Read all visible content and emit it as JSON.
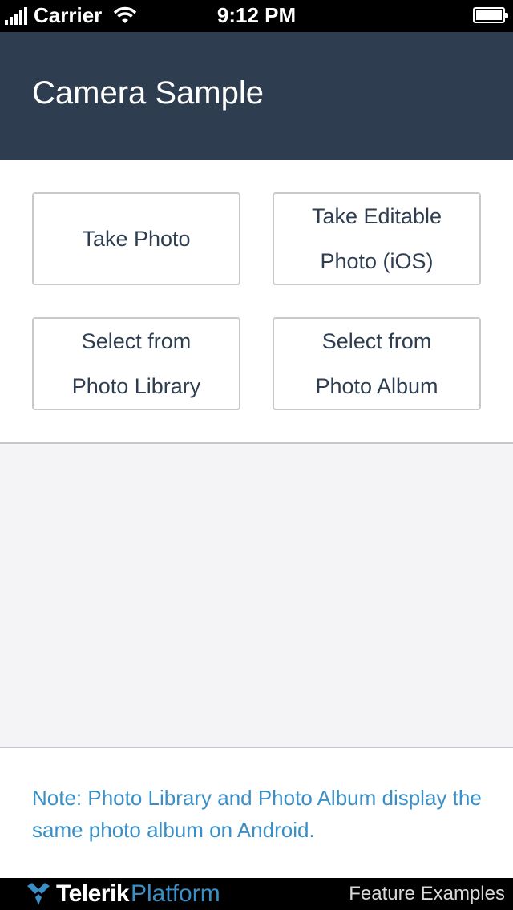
{
  "status_bar": {
    "carrier": "Carrier",
    "time": "9:12 PM",
    "icons": [
      "signal-icon",
      "wifi-icon",
      "battery-icon"
    ]
  },
  "header": {
    "title": "Camera Sample",
    "background": "#2e3e50"
  },
  "buttons": {
    "take_photo": "Take Photo",
    "take_editable_line1": "Take Editable",
    "take_editable_line2": "Photo (iOS)",
    "select_library_line1": "Select from",
    "select_library_line2": "Photo Library",
    "select_album_line1": "Select from",
    "select_album_line2": "Photo Album"
  },
  "note": {
    "text": "Note: Photo Library and Photo Album display the same photo album on Android.",
    "color": "#3a8fc6"
  },
  "footer": {
    "brand_main": "Telerik",
    "brand_sub": "Platform",
    "right_text": "Feature Examples"
  }
}
